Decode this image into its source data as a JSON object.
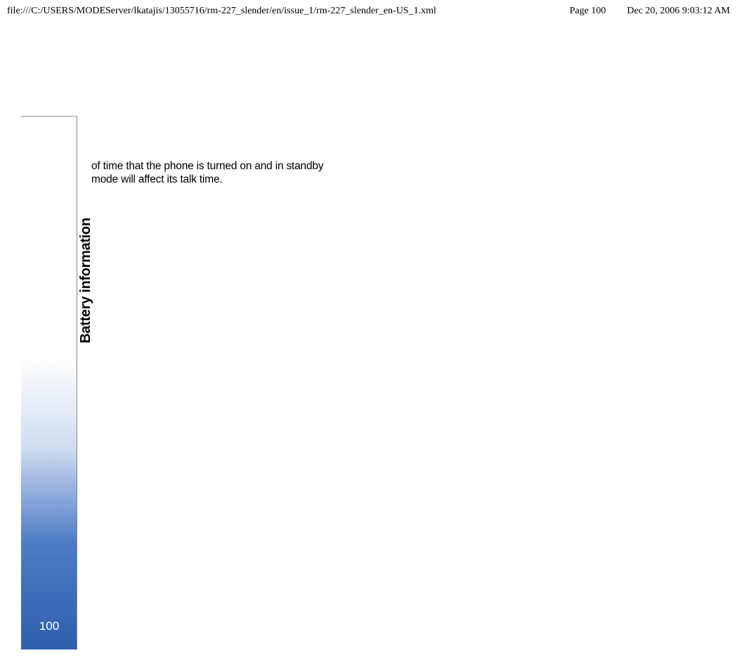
{
  "header": {
    "path": "file:///C:/USERS/MODEServer/lkatajis/13055716/rm-227_slender/en/issue_1/rm-227_slender_en-US_1.xml",
    "page_label": "Page 100",
    "date": "Dec 20, 2006 9:03:12 AM"
  },
  "sidebar": {
    "section_title": "Battery information",
    "page_number": "100"
  },
  "content": {
    "body_text": "of time that the phone is turned on and in standby mode will affect its talk time."
  }
}
